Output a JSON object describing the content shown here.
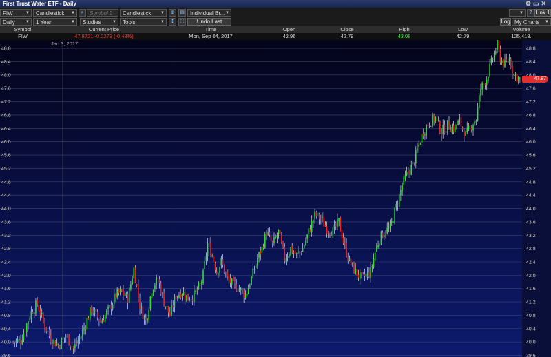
{
  "window": {
    "title": "First Trust Water ETF - Daily"
  },
  "toolbar": {
    "symbol": "FIW",
    "chart_type": "Candlestick",
    "symbol2_placeholder": "Symbol 2",
    "chart_type2": "Candlestick",
    "layout": "Individual Br...",
    "link": "Link 1",
    "interval": "Daily",
    "range": "1 Year",
    "studies": "Studies",
    "tools": "Tools",
    "undo": "Undo Last",
    "log": "Log",
    "my_charts": "My Charts"
  },
  "quote": {
    "headers": [
      "Symbol",
      "Current Price",
      "Time",
      "Open",
      "Close",
      "High",
      "Low",
      "Volume"
    ],
    "symbol": "FIW",
    "current_price": "47.8721 -0.2279 (-0.48%)",
    "time": "Mon, Sep 04, 2017",
    "open": "42.96",
    "close": "42.79",
    "high": "43.08",
    "low": "42.79",
    "volume": "125,418."
  },
  "colors": {
    "up": "#33dd33",
    "down": "#ee2222",
    "bg_top": "#04041a",
    "bg_bottom": "#0d1a6e"
  },
  "chart_data": {
    "type": "candlestick",
    "date_marker": "Jan 3, 2017",
    "ylim": [
      39.55,
      49.05
    ],
    "yticks": [
      39.6,
      40.0,
      40.4,
      40.8,
      41.2,
      41.6,
      42.0,
      42.4,
      42.8,
      43.2,
      43.6,
      44.0,
      44.4,
      44.8,
      45.2,
      45.6,
      46.0,
      46.4,
      46.8,
      47.2,
      47.6,
      48.0,
      48.4,
      48.8
    ],
    "price_label": "47.87",
    "last_price": 47.87,
    "approx_close_path": [
      [
        0,
        40.0
      ],
      [
        5,
        40.05
      ],
      [
        12,
        40.9
      ],
      [
        16,
        41.15
      ],
      [
        20,
        40.6
      ],
      [
        25,
        40.1
      ],
      [
        30,
        39.9
      ],
      [
        35,
        40.2
      ],
      [
        40,
        39.8
      ],
      [
        45,
        40.2
      ],
      [
        52,
        41.0
      ],
      [
        58,
        40.6
      ],
      [
        64,
        41.0
      ],
      [
        68,
        41.4
      ],
      [
        72,
        41.5
      ],
      [
        76,
        41.3
      ],
      [
        80,
        42.2
      ],
      [
        84,
        41.1
      ],
      [
        88,
        40.6
      ],
      [
        92,
        41.6
      ],
      [
        96,
        41.9
      ],
      [
        100,
        41.2
      ],
      [
        104,
        40.8
      ],
      [
        108,
        41.4
      ],
      [
        112,
        41.5
      ],
      [
        116,
        41.3
      ],
      [
        120,
        41.4
      ],
      [
        124,
        41.7
      ],
      [
        126,
        42.0
      ],
      [
        129,
        42.95
      ],
      [
        132,
        42.6
      ],
      [
        135,
        42.1
      ],
      [
        138,
        42.4
      ],
      [
        142,
        41.9
      ],
      [
        146,
        41.7
      ],
      [
        150,
        41.6
      ],
      [
        154,
        41.4
      ],
      [
        158,
        41.9
      ],
      [
        162,
        42.5
      ],
      [
        165,
        42.8
      ],
      [
        168,
        43.3
      ],
      [
        172,
        42.9
      ],
      [
        176,
        43.3
      ],
      [
        180,
        42.5
      ],
      [
        184,
        42.8
      ],
      [
        188,
        42.6
      ],
      [
        192,
        42.8
      ],
      [
        196,
        43.3
      ],
      [
        200,
        43.8
      ],
      [
        204,
        43.7
      ],
      [
        208,
        43.4
      ],
      [
        212,
        43.3
      ],
      [
        216,
        43.6
      ],
      [
        219,
        43.0
      ],
      [
        223,
        42.4
      ],
      [
        227,
        42.1
      ],
      [
        231,
        41.9
      ],
      [
        234,
        42.0
      ],
      [
        237,
        42.1
      ],
      [
        240,
        42.7
      ],
      [
        243,
        43.1
      ],
      [
        246,
        43.3
      ],
      [
        250,
        43.4
      ],
      [
        254,
        44.05
      ],
      [
        258,
        44.7
      ],
      [
        262,
        45.1
      ],
      [
        265,
        45.3
      ],
      [
        269,
        45.9
      ],
      [
        272,
        46.3
      ],
      [
        276,
        46.6
      ],
      [
        280,
        46.7
      ],
      [
        284,
        46.3
      ],
      [
        288,
        46.5
      ],
      [
        292,
        46.4
      ],
      [
        296,
        46.6
      ],
      [
        300,
        46.2
      ],
      [
        304,
        46.5
      ],
      [
        307,
        46.7
      ],
      [
        310,
        47.6
      ],
      [
        314,
        47.9
      ],
      [
        318,
        48.5
      ],
      [
        321,
        48.9
      ],
      [
        323,
        48.5
      ],
      [
        326,
        48.3
      ],
      [
        329,
        48.5
      ],
      [
        332,
        48.0
      ],
      [
        336,
        47.87
      ]
    ]
  }
}
